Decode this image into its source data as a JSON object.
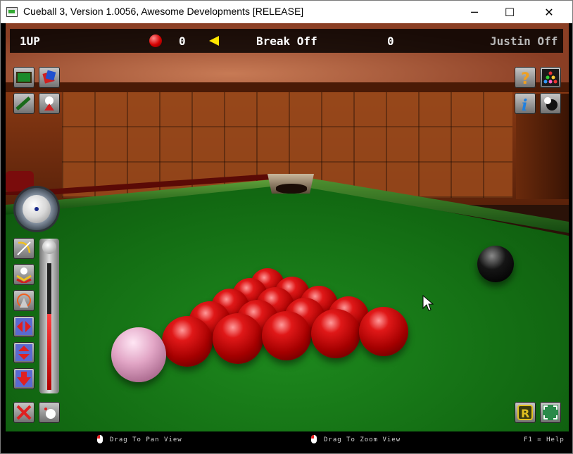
{
  "window": {
    "title": "Cueball 3, Version 1.0056, Awesome Developments [RELEASE]",
    "minimize_glyph": "─",
    "maximize_glyph": "☐",
    "close_glyph": "✕"
  },
  "hud": {
    "player1_label": "1UP",
    "player1_score": "0",
    "match_status": "Break Off",
    "player2_score": "0",
    "player2_name": "Justin Off",
    "ball_on_color": "#d40000",
    "turn_indicator_color": "#ffe600"
  },
  "left_tools": [
    "table-view-icon",
    "dice-icon",
    "cue-angle-icon",
    "player-icon"
  ],
  "right_tools": [
    "help-icon",
    "rack-icon",
    "info-icon",
    "cueball-icon"
  ],
  "shot_controls": [
    "aim-icon",
    "spin-icon",
    "target-icon",
    "left-right-arrows-icon",
    "up-down-arrows-icon",
    "drop-icon"
  ],
  "power_level": 0.6,
  "bottom_left_tools": [
    "cancel-icon",
    "replay-ball-icon"
  ],
  "bottom_right_tools": [
    "replay-icon",
    "camera-icon"
  ],
  "bottombar": {
    "pan_hint": "Drag To Pan View",
    "zoom_hint": "Drag To Zoom View",
    "help_hint": "F1 = Help"
  }
}
